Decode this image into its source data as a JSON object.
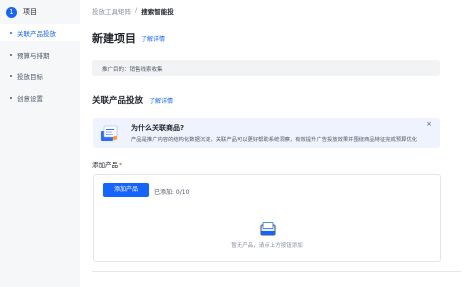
{
  "sidebar": {
    "step": {
      "number": "1",
      "label": "项目"
    },
    "items": [
      {
        "label": "关联产品投放",
        "active": true
      },
      {
        "label": "预算与排期",
        "active": false
      },
      {
        "label": "投放目标",
        "active": false
      },
      {
        "label": "创意设置",
        "active": false
      }
    ]
  },
  "breadcrumb": {
    "parent": "投放工具矩阵",
    "separator": "/",
    "current": "搜索智能投"
  },
  "header": {
    "title": "新建项目",
    "link": "了解详情"
  },
  "purpose": {
    "text": "推广目的：销售线索收集"
  },
  "section": {
    "title": "关联产品投放",
    "link": "了解详情",
    "info": {
      "title": "为什么关联商品?",
      "desc": "产品是推广内容的结构化数据沉淀，关联产品可以更好帮助系统洞察，有效提升广告投放效果并围绕商品特征完成预算优化",
      "close": "×"
    },
    "field": {
      "label": "添加产品",
      "required": "*"
    },
    "add_button": "添加产品",
    "added_count": "已添加: 0/10",
    "empty_text": "暂无产品，请点上方按钮添加"
  },
  "colors": {
    "accent": "#1664ff",
    "required": "#f53f3f"
  },
  "icons": {
    "empty": "empty-box-icon",
    "illustration": "info-illustration-icon"
  }
}
